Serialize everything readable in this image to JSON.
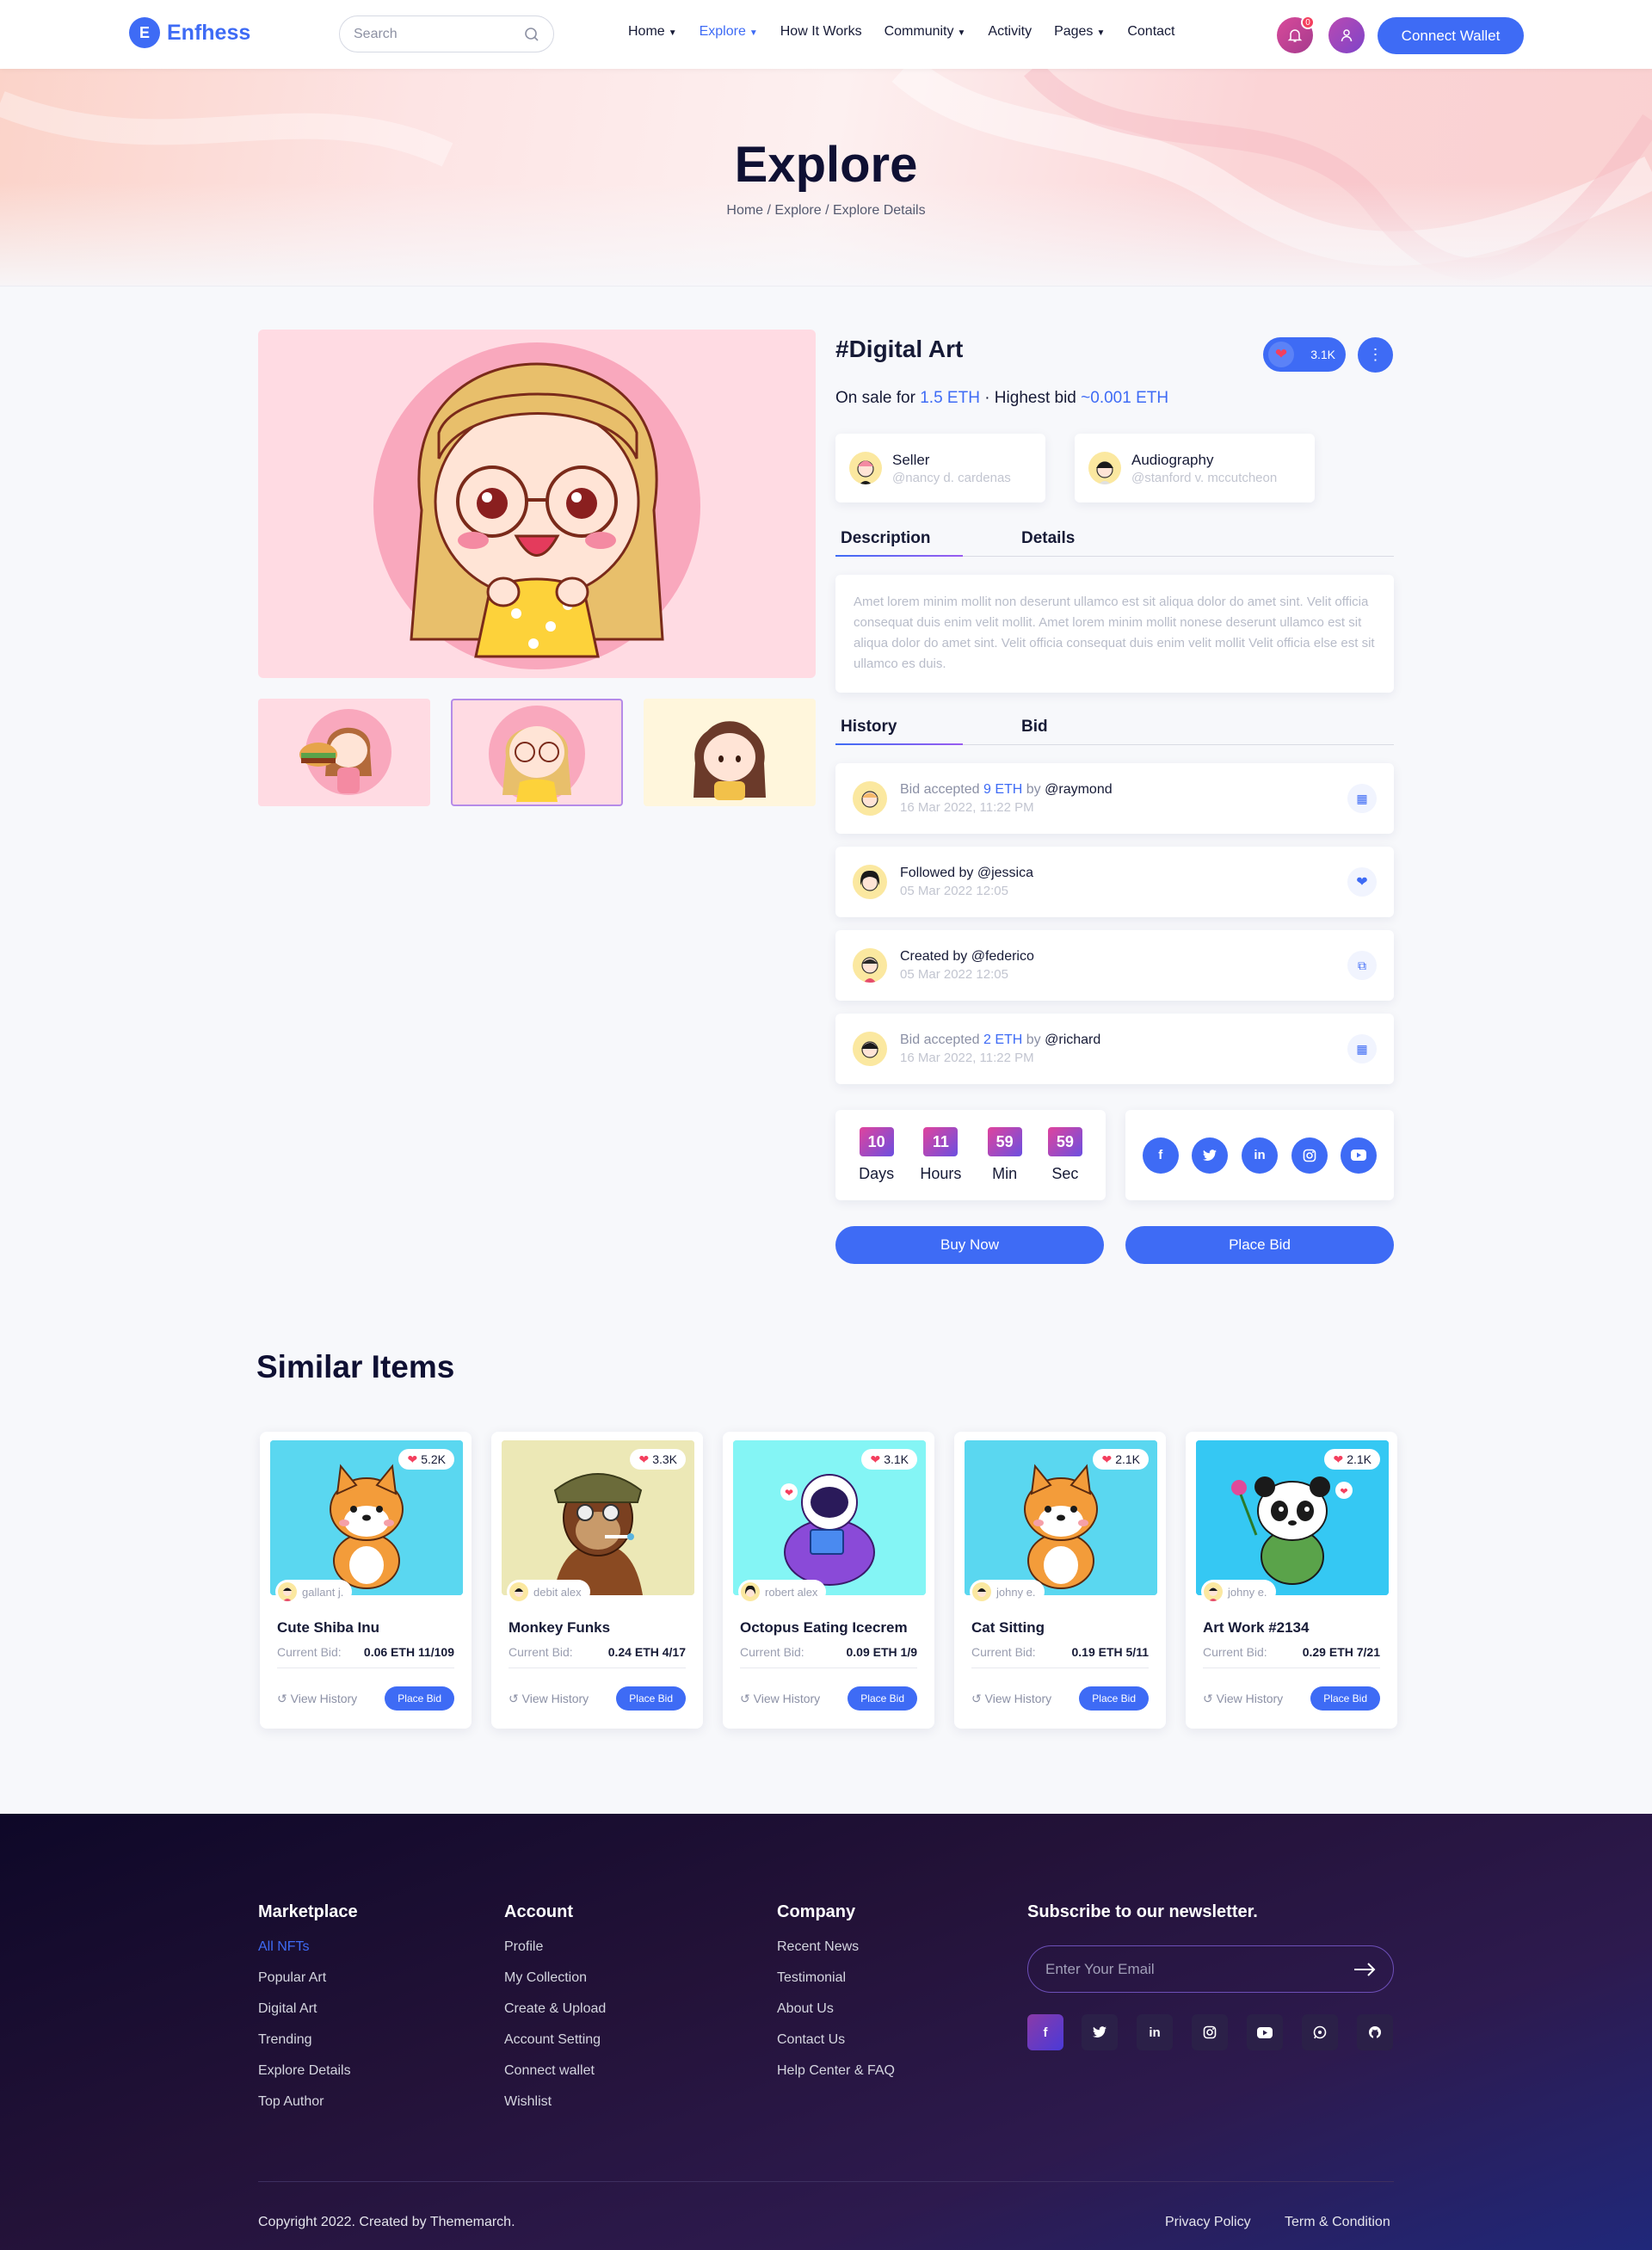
{
  "brand": {
    "name": "Enfhess",
    "accent": "#3e6bf5"
  },
  "search": {
    "placeholder": "Search"
  },
  "nav": {
    "items": [
      "Home",
      "Explore",
      "How It Works",
      "Community",
      "Activity",
      "Pages",
      "Contact"
    ]
  },
  "header": {
    "notification_count": "0",
    "connect_label": "Connect Wallet"
  },
  "hero": {
    "title": "Explore",
    "breadcrumb": "Home / Explore / Explore Details"
  },
  "item": {
    "title": "#Digital Art",
    "likes": "3.1K",
    "sale_prefix": "On sale for",
    "sale_price": "1.5 ETH",
    "sale_mid": "· Highest bid",
    "highest_bid": "~0.001 ETH",
    "seller": {
      "label": "Seller",
      "handle": "@nancy d. cardenas"
    },
    "creator": {
      "label": "Audiography",
      "handle": "@stanford v. mccutcheon"
    },
    "tabs": [
      "Description",
      "Details"
    ],
    "description": "Amet lorem minim mollit non deserunt ullamco est sit aliqua dolor do amet sint. Velit officia consequat duis enim velit mollit. Amet lorem minim mollit nonese deserunt ullamco est sit aliqua dolor do amet sint. Velit officia consequat duis enim velit mollit Velit officia else est sit ullamco es duis.",
    "history_tabs": [
      "History",
      "Bid"
    ],
    "history": [
      {
        "pre": "Bid accepted",
        "amount": "9 ETH",
        "by": "by",
        "user": "@raymond",
        "time": "16 Mar 2022, 11:22 PM",
        "icon": "wallet-icon"
      },
      {
        "pre": "Followed by",
        "amount": "",
        "by": "",
        "user": "@jessica",
        "time": "05 Mar 2022 12:05",
        "icon": "heart-icon"
      },
      {
        "pre": "Created by",
        "amount": "",
        "by": "",
        "user": "@federico",
        "time": "05 Mar 2022 12:05",
        "icon": "copy-icon"
      },
      {
        "pre": "Bid accepted",
        "amount": "2 ETH",
        "by": "by",
        "user": "@richard",
        "time": "16 Mar 2022, 11:22 PM",
        "icon": "wallet-icon"
      }
    ],
    "countdown": [
      {
        "value": "10",
        "label": "Days"
      },
      {
        "value": "11",
        "label": "Hours"
      },
      {
        "value": "59",
        "label": "Min"
      },
      {
        "value": "59",
        "label": "Sec"
      }
    ],
    "social": [
      "facebook-icon",
      "twitter-icon",
      "linkedin-icon",
      "instagram-icon",
      "youtube-icon"
    ],
    "buy_label": "Buy Now",
    "bid_label": "Place Bid"
  },
  "similar": {
    "title": "Similar Items",
    "bid_label": "Current Bid:",
    "history_label": "View History",
    "button_label": "Place Bid",
    "cards": [
      {
        "name": "Cute Shiba Inu",
        "likes": "5.2K",
        "owner": "gallant j.",
        "bid": "0.06 ETH 11/109",
        "bg": "#5ad7f0"
      },
      {
        "name": "Monkey Funks",
        "likes": "3.3K",
        "owner": "debit alex",
        "bid": "0.24 ETH 4/17",
        "bg": "#ece8b6"
      },
      {
        "name": "Octopus Eating Icecrem",
        "likes": "3.1K",
        "owner": "robert alex",
        "bid": "0.09 ETH 1/9",
        "bg": "#84f5f5"
      },
      {
        "name": "Cat Sitting",
        "likes": "2.1K",
        "owner": "johny e.",
        "bid": "0.19 ETH 5/11",
        "bg": "#5ad7f0"
      },
      {
        "name": "Art Work #2134",
        "likes": "2.1K",
        "owner": "johny e.",
        "bid": "0.29 ETH 7/21",
        "bg": "#35c8f3"
      }
    ]
  },
  "footer": {
    "columns": [
      {
        "title": "Marketplace",
        "links": [
          "All NFTs",
          "Popular Art",
          "Digital Art",
          "Trending",
          "Explore Details",
          "Top Author"
        ]
      },
      {
        "title": "Account",
        "links": [
          "Profile",
          "My Collection",
          "Create & Upload",
          "Account Setting",
          "Connect wallet",
          "Wishlist"
        ]
      },
      {
        "title": "Company",
        "links": [
          "Recent News",
          "Testimonial",
          "About Us",
          "Contact Us",
          "Help Center & FAQ"
        ]
      }
    ],
    "newsletter_title": "Subscribe to our newsletter.",
    "email_placeholder": "Enter Your Email",
    "social": [
      "facebook-icon",
      "twitter-icon",
      "linkedin-icon",
      "instagram-icon",
      "youtube-icon",
      "whatsapp-icon",
      "github-icon"
    ],
    "copyright": "Copyright 2022. Created by Thememarch.",
    "links": [
      "Privacy Policy",
      "Term & Condition"
    ]
  }
}
